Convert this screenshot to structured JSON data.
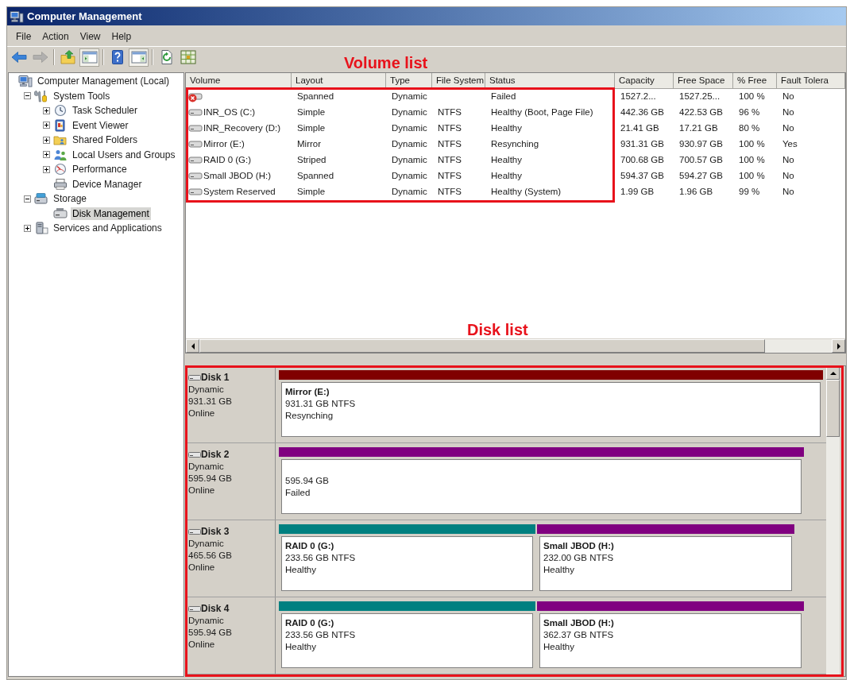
{
  "window": {
    "title": "Computer Management"
  },
  "menu": [
    "File",
    "Action",
    "View",
    "Help"
  ],
  "toolbar": {
    "groups": [
      [
        {
          "kind": "back",
          "disabled": false,
          "pressed": false
        },
        {
          "kind": "forward",
          "disabled": true,
          "pressed": false
        }
      ],
      [
        {
          "kind": "up",
          "disabled": false,
          "pressed": false
        },
        {
          "kind": "console-tree",
          "disabled": false,
          "pressed": true
        }
      ],
      [
        {
          "kind": "help",
          "disabled": false,
          "pressed": false
        },
        {
          "kind": "action-pane",
          "disabled": false,
          "pressed": true
        }
      ],
      [
        {
          "kind": "export",
          "disabled": false,
          "pressed": false
        },
        {
          "kind": "properties",
          "disabled": false,
          "pressed": false
        }
      ]
    ]
  },
  "tree": [
    {
      "label": "Computer Management (Local)",
      "kind": "computer",
      "selected": false,
      "children": [
        {
          "label": "System Tools",
          "kind": "tools",
          "expanded": true,
          "selected": false,
          "children": [
            {
              "label": "Task Scheduler",
              "kind": "clock",
              "expanded": false,
              "selected": false
            },
            {
              "label": "Event Viewer",
              "kind": "event-log",
              "expanded": false,
              "selected": false
            },
            {
              "label": "Shared Folders",
              "kind": "shared-folders",
              "expanded": false,
              "selected": false
            },
            {
              "label": "Local Users and Groups",
              "kind": "users",
              "expanded": false,
              "selected": false
            },
            {
              "label": "Performance",
              "kind": "performance",
              "expanded": false,
              "selected": false
            },
            {
              "label": "Device Manager",
              "kind": "device-manager",
              "selected": false
            }
          ]
        },
        {
          "label": "Storage",
          "kind": "storage",
          "expanded": true,
          "selected": false,
          "children": [
            {
              "label": "Disk Management",
              "kind": "disk",
              "selected": true
            }
          ]
        },
        {
          "label": "Services and Applications",
          "kind": "services",
          "expanded": false,
          "selected": false
        }
      ]
    }
  ],
  "volume_list": {
    "annotation": "Volume list",
    "columns": [
      "Volume",
      "Layout",
      "Type",
      "File System",
      "Status",
      "Capacity",
      "Free Space",
      "% Free",
      "Fault Tolera"
    ],
    "rows": [
      {
        "failed": true,
        "layout": "Spanned",
        "type": "Dynamic",
        "status": "Failed",
        "capacity": "1527.2...",
        "free_space": "1527.25...",
        "percent_free": "100 %",
        "fault_tolerance": "No"
      },
      {
        "failed": false,
        "volume": "INR_OS (C:)",
        "layout": "Simple",
        "type": "Dynamic",
        "file_system": "NTFS",
        "status": "Healthy (Boot, Page File)",
        "capacity": "442.36 GB",
        "free_space": "422.53 GB",
        "percent_free": "96 %",
        "fault_tolerance": "No"
      },
      {
        "failed": false,
        "volume": "INR_Recovery (D:)",
        "layout": "Simple",
        "type": "Dynamic",
        "file_system": "NTFS",
        "status": "Healthy",
        "capacity": "21.41 GB",
        "free_space": "17.21 GB",
        "percent_free": "80 %",
        "fault_tolerance": "No"
      },
      {
        "failed": false,
        "volume": "Mirror (E:)",
        "layout": "Mirror",
        "type": "Dynamic",
        "file_system": "NTFS",
        "status": "Resynching",
        "capacity": "931.31 GB",
        "free_space": "930.97 GB",
        "percent_free": "100 %",
        "fault_tolerance": "Yes"
      },
      {
        "failed": false,
        "volume": "RAID 0 (G:)",
        "layout": "Striped",
        "type": "Dynamic",
        "file_system": "NTFS",
        "status": "Healthy",
        "capacity": "700.68 GB",
        "free_space": "700.57 GB",
        "percent_free": "100 %",
        "fault_tolerance": "No"
      },
      {
        "failed": false,
        "volume": "Small JBOD (H:)",
        "layout": "Spanned",
        "type": "Dynamic",
        "file_system": "NTFS",
        "status": "Healthy",
        "capacity": "594.37 GB",
        "free_space": "594.27 GB",
        "percent_free": "100 %",
        "fault_tolerance": "No"
      },
      {
        "failed": false,
        "volume": "System Reserved",
        "layout": "Simple",
        "type": "Dynamic",
        "file_system": "NTFS",
        "status": "Healthy (System)",
        "capacity": "1.99 GB",
        "free_space": "1.96 GB",
        "percent_free": "99 %",
        "fault_tolerance": "No"
      }
    ]
  },
  "disk_list": {
    "annotation": "Disk list",
    "disks": [
      {
        "name": "Disk 1",
        "type": "Dynamic",
        "size": "931.31 GB",
        "status": "Online",
        "partitions": [
          {
            "name": "Mirror (E:)",
            "size": "931.31 GB NTFS",
            "status": "Resynching",
            "color": "#800000"
          }
        ]
      },
      {
        "name": "Disk 2",
        "type": "Dynamic",
        "size": "595.94 GB",
        "status": "Online",
        "partitions": [
          {
            "size": "595.94 GB",
            "status": "Failed",
            "color": "#800080"
          }
        ]
      },
      {
        "name": "Disk 3",
        "type": "Dynamic",
        "size": "465.56 GB",
        "status": "Online",
        "partitions": [
          {
            "name": "RAID 0 (G:)",
            "size": "233.56 GB NTFS",
            "status": "Healthy",
            "color": "#008080"
          },
          {
            "name": "Small JBOD (H:)",
            "size": "232.00 GB NTFS",
            "status": "Healthy",
            "color": "#800080"
          }
        ]
      },
      {
        "name": "Disk 4",
        "type": "Dynamic",
        "size": "595.94 GB",
        "status": "Online",
        "partitions": [
          {
            "name": "RAID 0 (G:)",
            "size": "233.56 GB NTFS",
            "status": "Healthy",
            "color": "#008080"
          },
          {
            "name": "Small JBOD (H:)",
            "size": "362.37 GB NTFS",
            "status": "Healthy",
            "color": "#800080"
          }
        ]
      }
    ]
  }
}
